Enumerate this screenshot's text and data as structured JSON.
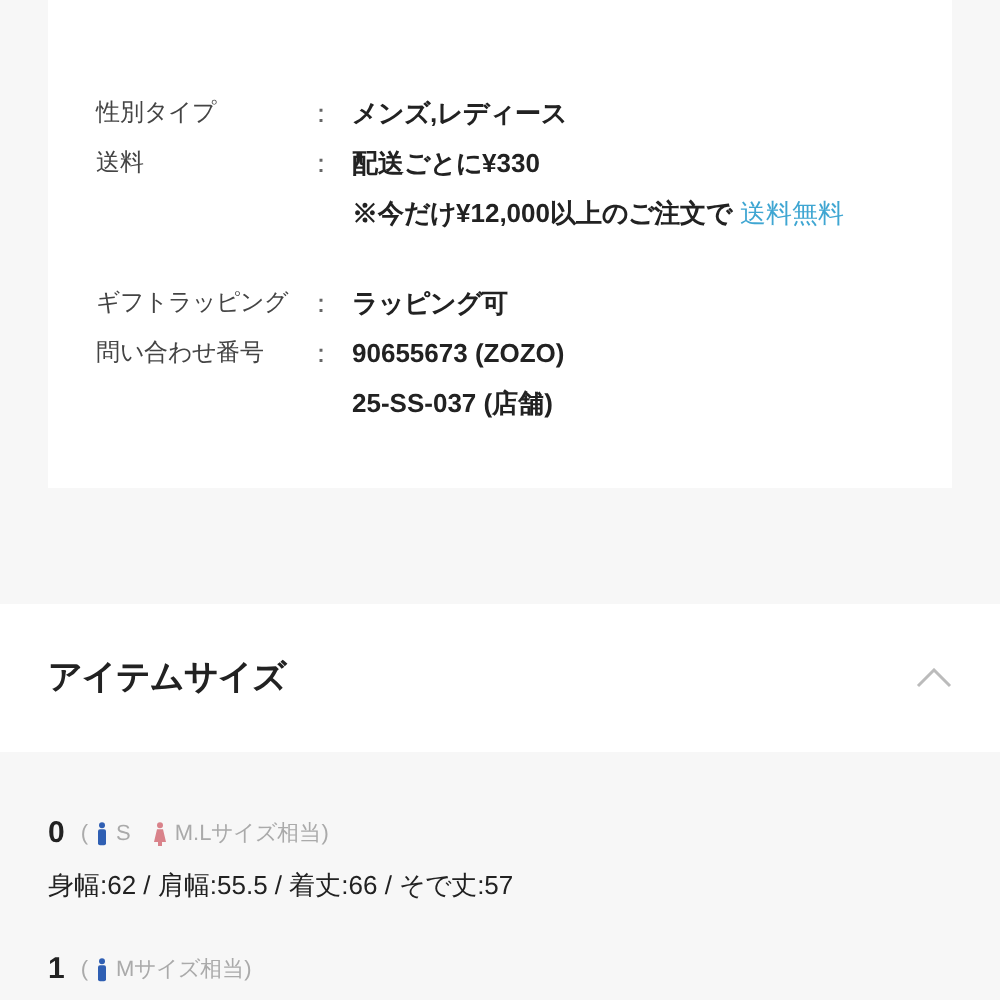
{
  "detail_groups": [
    [
      {
        "label": "性別タイプ",
        "lines": [
          {
            "text": "メンズ,レディース"
          }
        ]
      },
      {
        "label": "送料",
        "lines": [
          {
            "text": "配送ごとに¥330"
          },
          {
            "text": "※今だけ¥12,000以上のご注文で",
            "link": "送料無料"
          }
        ]
      }
    ],
    [
      {
        "label": "ギフトラッピング",
        "lines": [
          {
            "text": "ラッピング可"
          }
        ]
      },
      {
        "label": "問い合わせ番号",
        "lines": [
          {
            "text": "90655673 (ZOZO)"
          },
          {
            "text": "25-SS-037 (店舗)"
          }
        ]
      }
    ]
  ],
  "separator": "：",
  "item_size": {
    "title": "アイテムサイズ",
    "expanded": true,
    "sizes": [
      {
        "size": "0",
        "open": "(",
        "fits": [
          {
            "kind": "men",
            "text": "S"
          },
          {
            "kind": "women",
            "text": "M.Lサイズ相当)"
          }
        ],
        "measurements": "身幅:62 / 肩幅:55.5 / 着丈:66 / そで丈:57"
      },
      {
        "size": "1",
        "open": "(",
        "fits": [
          {
            "kind": "men",
            "text": "Mサイズ相当)"
          }
        ]
      }
    ]
  }
}
